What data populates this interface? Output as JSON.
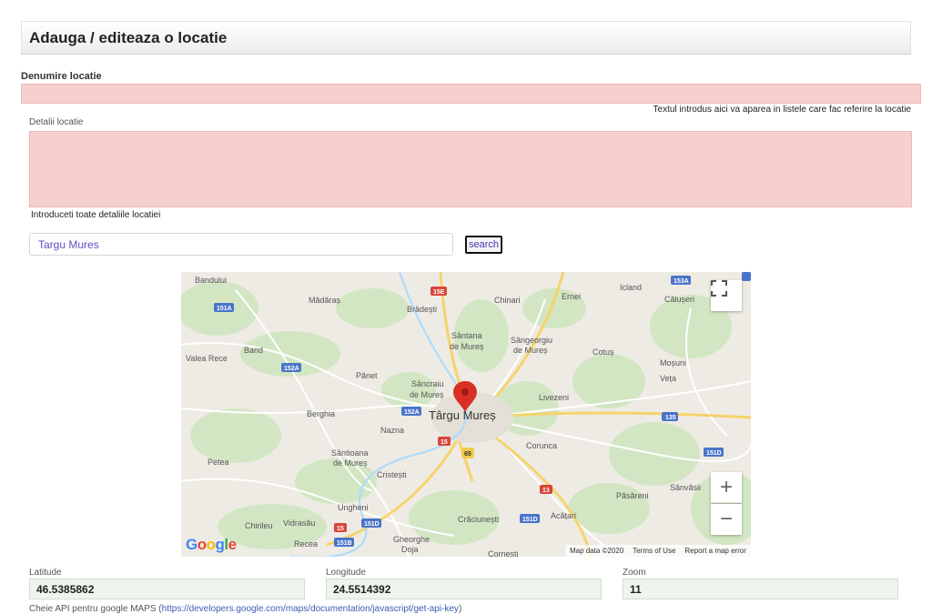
{
  "page": {
    "title": "Adauga / editeaza o locatie"
  },
  "form": {
    "name_label": "Denumire locatie",
    "name_value": "",
    "name_hint": "Textul introdus aici va aparea in listele care fac referire la locatie",
    "details_label": "Detalii locatie",
    "details_value": "",
    "details_hint": "Introduceti toate detaliile locatiei",
    "search_value": "Targu Mures",
    "search_button": "search"
  },
  "map": {
    "city_label": "Târgu Mureș",
    "logo": "Google",
    "footer": {
      "data": "Map data ©2020",
      "terms": "Terms of Use",
      "report": "Report a map error"
    },
    "zoom_in": "+",
    "zoom_out": "−",
    "fullscreen_icon": "fullscreen-icon",
    "marker_icon": "map-pin-icon",
    "marker_color": "#d93025",
    "places": [
      "Bandului",
      "Mădăraș",
      "Brâdești",
      "Chinari",
      "Ernei",
      "Icland",
      "Călușeri",
      "Sântana de Mureș",
      "Sângeorgiu de Mureș",
      "Band",
      "Valea Rece",
      "Pănet",
      "Cotuș",
      "Moșuni",
      "Veța",
      "Sâncraiu de Mureș",
      "Livezeni",
      "Berghia",
      "Nazna",
      "Corunca",
      "Petea",
      "Sântioana de Mureș",
      "Cristești",
      "Sânvăsii",
      "Ungheni",
      "Păsăreni",
      "Chirileu",
      "Vidrasău",
      "Crăciunești",
      "Acățari",
      "Recea",
      "Gheorghe Doja",
      "Cornești"
    ],
    "roads": [
      "151A",
      "15E",
      "153A",
      "152A",
      "135",
      "15",
      "65",
      "151D",
      "13",
      "151B"
    ]
  },
  "coords": {
    "latitude_label": "Latitude",
    "latitude_value": "46.5385862",
    "longitude_label": "Longitude",
    "longitude_value": "24.5514392",
    "zoom_label": "Zoom",
    "zoom_value": "11"
  },
  "api": {
    "text": "Cheie API pentru google MAPS (",
    "link": "https://developers.google.com/maps/documentation/javascript/get-api-key",
    "close": ")"
  },
  "colors": {
    "invalid_field": "#f6cfcf",
    "coord_field": "#eef5ec",
    "link": "#3b5bb5"
  }
}
